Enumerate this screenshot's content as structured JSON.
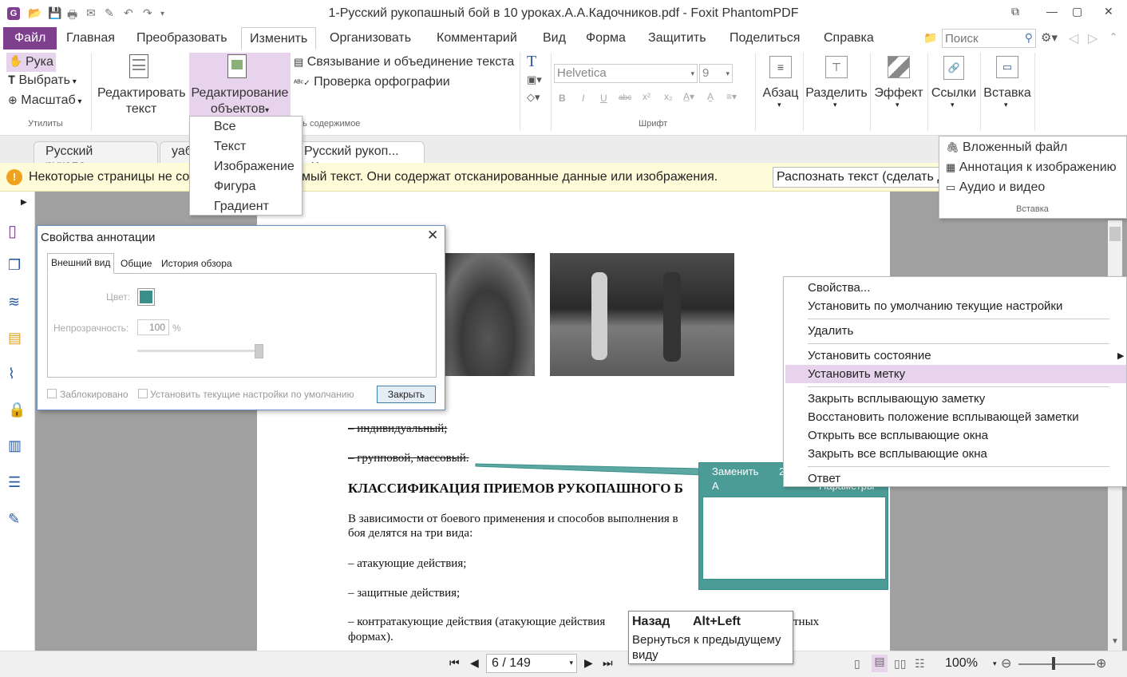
{
  "window": {
    "title": "1-Русский рукопашный бой в 10 уроках.А.А.Кадочников.pdf - Foxit PhantomPDF"
  },
  "menu": {
    "file": "Файл",
    "items": [
      "Главная",
      "Преобразовать",
      "Изменить",
      "Организовать",
      "Комментарий",
      "Вид",
      "Форма",
      "Защитить",
      "Поделиться",
      "Справка"
    ],
    "search_placeholder": "Поиск"
  },
  "ribbon": {
    "hand": "Рука",
    "select": "Выбрать",
    "zoom": "Масштаб",
    "utilities": "Утилиты",
    "edit_text_1": "Редактировать",
    "edit_text_2": "текст",
    "edit_objects_1": "Редактирование",
    "edit_objects_2": "объектов",
    "link_text": "Связывание и объединение текста",
    "spell": "Проверка орфографии",
    "content_group": "ить содержимое",
    "font": "Helvetica",
    "size": "9",
    "font_group": "Шрифт",
    "paragraph": "Абзац",
    "split": "Разделить",
    "effect": "Эффект",
    "links": "Ссылки",
    "insert": "Вставка"
  },
  "objects_menu": [
    "Все",
    "Текст",
    "Изображение",
    "Фигура",
    "Градиент"
  ],
  "insert_menu": {
    "items": [
      "Вложенный файл",
      "Аннотация к изображению",
      "Аудио и видео"
    ],
    "group": "Вставка"
  },
  "tabs": [
    "Русский рукопа...",
    "уаб",
    "Русский рукоп..."
  ],
  "infobar": {
    "text_left": "Некоторые страницы не сод",
    "text_right": "мый текст. Они содержат отсканированные данные или изображения.",
    "button": "Распознать текст (сделать д"
  },
  "dialog": {
    "title": "Свойства аннотации",
    "tabs": [
      "Внешний вид",
      "Общие",
      "История обзора"
    ],
    "color_label": "Цвет:",
    "opacity_label": "Непрозрачность:",
    "opacity_value": "100",
    "percent": "%",
    "locked": "Заблокировано",
    "default": "Установить текущие настройки по умолчанию",
    "close": "Закрыть",
    "color": "#3a8f8a"
  },
  "document": {
    "item1": "– индивидуальный;",
    "item2": "– групповой, массовый.",
    "heading": "КЛАССИФИКАЦИЯ ПРИЕМОВ РУКОПАШНОГО Б",
    "para1": "В зависимости от боевого применения и способов выполнения в",
    "para2": "боя делятся на три вида:",
    "b1": "– атакующие действия;",
    "b2": "– защитные действия;",
    "b3a": "– контратакующие действия (атакующие действия",
    "b3b": "тных",
    "b3c": "формах)."
  },
  "popup_note": {
    "title": "Заменить",
    "num": "2",
    "author": "А",
    "options": "Параметры"
  },
  "context_menu": [
    "Свойства...",
    "Установить по умолчанию текущие настройки",
    "Удалить",
    "Установить состояние",
    "Установить метку",
    "Закрыть всплывающую заметку",
    "Восстановить положение всплывающей заметки",
    "Открыть все всплывающие окна",
    "Закрыть все всплывающие окна",
    "Ответ"
  ],
  "tooltip": {
    "title": "Назад",
    "shortcut": "Alt+Left",
    "body1": "Вернуться к предыдущему",
    "body2": "виду"
  },
  "status": {
    "page": "6 / 149",
    "zoom": "100%"
  }
}
